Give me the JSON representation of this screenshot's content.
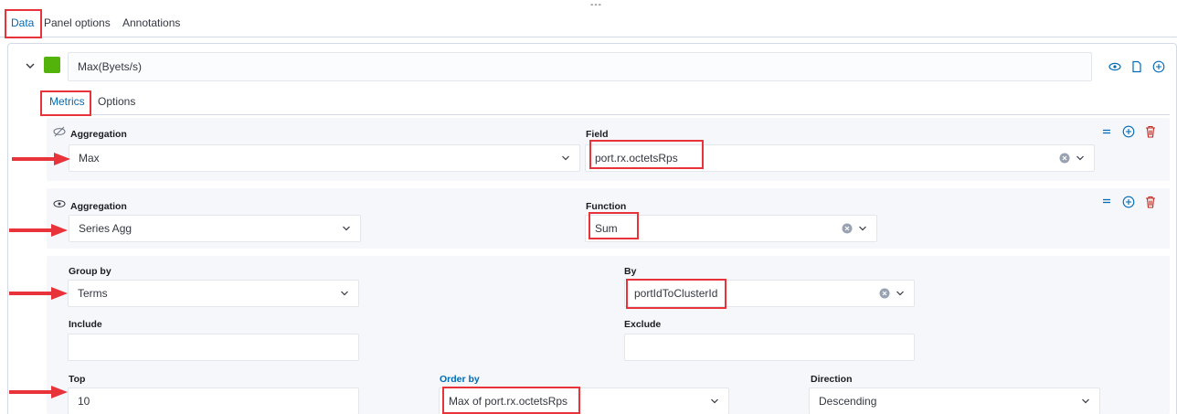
{
  "top_ellipsis": "---",
  "top_tabs": [
    "Data",
    "Panel options",
    "Annotations"
  ],
  "series": {
    "label": "Max(Byets/s)",
    "color": "#54b30b"
  },
  "sub_tabs": [
    "Metrics",
    "Options"
  ],
  "metric1": {
    "aggregation_label": "Aggregation",
    "aggregation_value": "Max",
    "field_label": "Field",
    "field_value": "port.rx.octetsRps"
  },
  "metric2": {
    "aggregation_label": "Aggregation",
    "aggregation_value": "Series Agg",
    "function_label": "Function",
    "function_value": "Sum"
  },
  "group": {
    "group_by_label": "Group by",
    "group_by_value": "Terms",
    "by_label": "By",
    "by_value": "portIdToClusterId",
    "include_label": "Include",
    "include_value": "",
    "exclude_label": "Exclude",
    "exclude_value": "",
    "top_label": "Top",
    "top_value": "10",
    "order_by_label": "Order by",
    "order_by_value": "Max of port.rx.octetsRps",
    "direction_label": "Direction",
    "direction_value": "Descending"
  },
  "colors": {
    "accent": "#006bb4",
    "highlight": "#e8333a",
    "delete": "#bd271e"
  }
}
